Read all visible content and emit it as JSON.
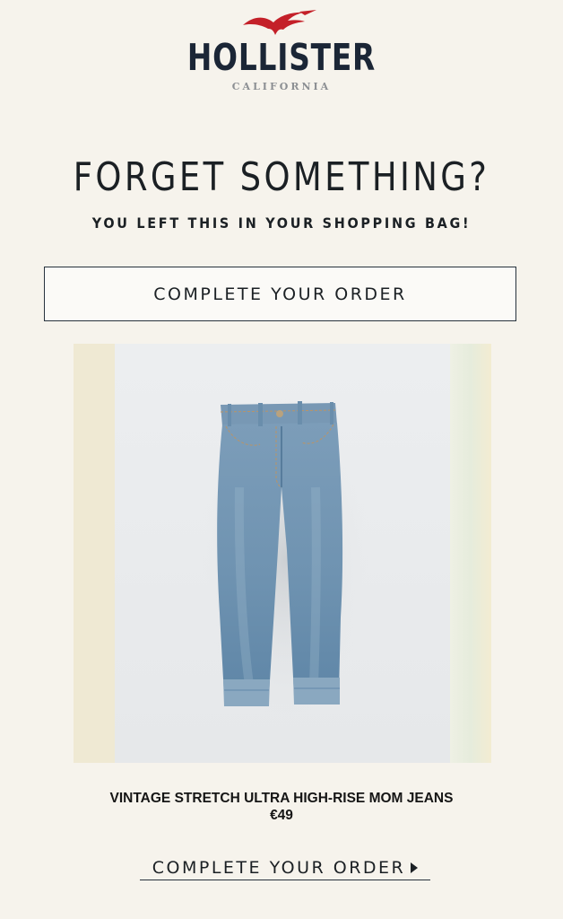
{
  "brand": {
    "name": "HOLLISTER",
    "subtitle": "CALIFORNIA",
    "logo_icon": "seagull-icon",
    "logo_color": "#c42029"
  },
  "header": {
    "headline": "FORGET SOMETHING?",
    "subline": "YOU LEFT THIS IN YOUR SHOPPING BAG!"
  },
  "cta_primary": {
    "label": "COMPLETE YOUR ORDER"
  },
  "product": {
    "image": "vintage-mom-jeans-image",
    "name": "VINTAGE STRETCH ULTRA HIGH-RISE MOM JEANS",
    "price": "€49"
  },
  "cta_secondary": {
    "label": "COMPLETE YOUR ORDER",
    "icon": "arrow-right-icon"
  },
  "colors": {
    "background": "#f6f3ec",
    "text": "#1b2024",
    "denim": "#6f93b1"
  }
}
